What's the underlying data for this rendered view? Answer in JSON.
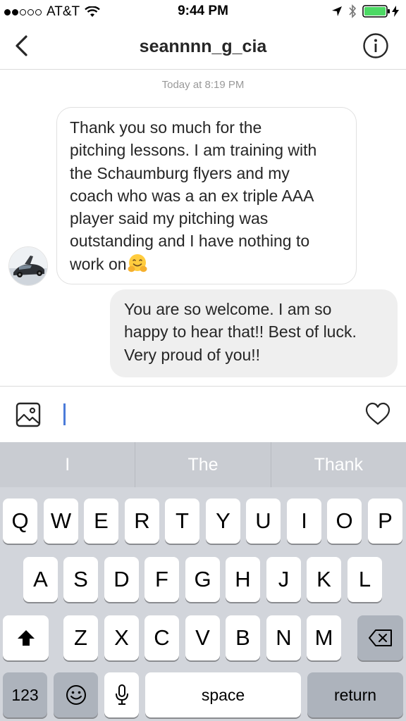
{
  "status_bar": {
    "carrier": "AT&T",
    "time": "9:44 PM",
    "signal_dots": [
      true,
      true,
      false,
      false,
      false
    ],
    "battery_color": "#4cd964"
  },
  "header": {
    "title": "seannnn_g_cia",
    "back_icon": "chevron-left-icon",
    "info_icon": "info-icon"
  },
  "conversation": {
    "timestamp": "Today at 8:19 PM",
    "messages": [
      {
        "sender": "other",
        "lines": [
          "Thank you so much for the",
          "pitching lessons. I am training with",
          "the Schaumburg flyers and my",
          "coach who was a an ex triple AAA",
          "player said my pitching was",
          "outstanding and I have nothing to",
          "work on"
        ],
        "trailing_emoji": "hugging-face-emoji"
      },
      {
        "sender": "me",
        "lines": [
          "You are so welcome. I am so",
          "happy to hear that!! Best of luck.",
          "Very proud of you!!"
        ]
      }
    ]
  },
  "composer": {
    "value": "",
    "gallery_icon": "image-gallery-icon",
    "like_icon": "heart-icon",
    "caret_color": "#4b7bd9"
  },
  "keyboard": {
    "predictions": [
      "I",
      "The",
      "Thank"
    ],
    "row1": [
      "Q",
      "W",
      "E",
      "R",
      "T",
      "Y",
      "U",
      "I",
      "O",
      "P"
    ],
    "row2": [
      "A",
      "S",
      "D",
      "F",
      "G",
      "H",
      "J",
      "K",
      "L"
    ],
    "row3": [
      "Z",
      "X",
      "C",
      "V",
      "B",
      "N",
      "M"
    ],
    "numbers_label": "123",
    "space_label": "space",
    "return_label": "return"
  }
}
